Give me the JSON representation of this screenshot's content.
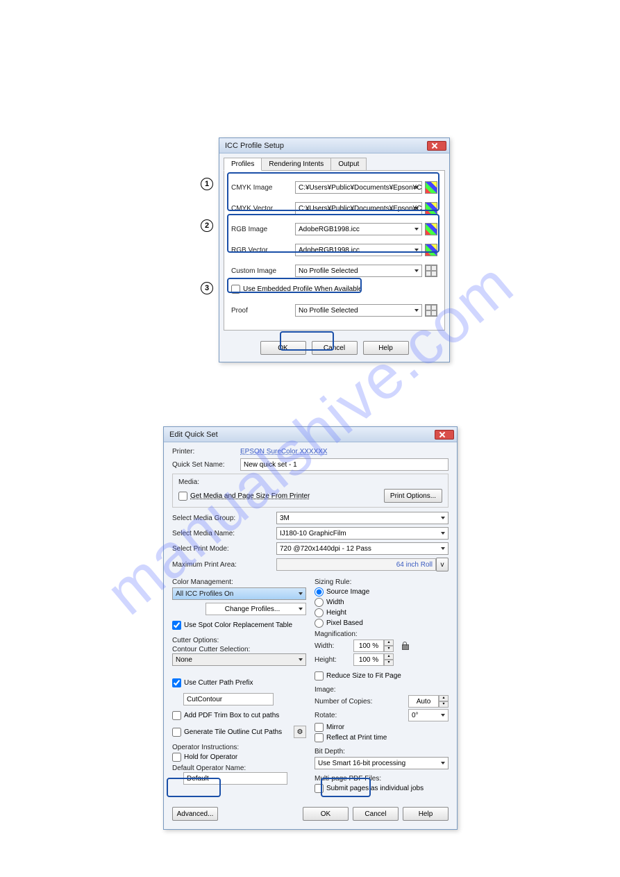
{
  "watermark": "manualshive.com",
  "icc": {
    "title": "ICC Profile Setup",
    "tabs": [
      "Profiles",
      "Rendering Intents",
      "Output"
    ],
    "rows": {
      "cmyk_image": {
        "label": "CMYK Image",
        "value": "C:¥Users¥Public¥Documents¥Epson¥C"
      },
      "cmyk_vector": {
        "label": "CMYK Vector",
        "value": "C:¥Users¥Public¥Documents¥Epson¥C"
      },
      "rgb_image": {
        "label": "RGB Image",
        "value": "AdobeRGB1998.icc"
      },
      "rgb_vector": {
        "label": "RGB Vector",
        "value": "AdobeRGB1998.icc"
      },
      "custom_image": {
        "label": "Custom Image",
        "value": "No Profile Selected"
      },
      "proof": {
        "label": "Proof",
        "value": "No Profile Selected"
      }
    },
    "use_embedded": "Use Embedded Profile When Available",
    "buttons": {
      "ok": "OK",
      "cancel": "Cancel",
      "help": "Help"
    },
    "callouts": {
      "one": "1",
      "two": "2",
      "three": "3"
    }
  },
  "eqs": {
    "title": "Edit Quick Set",
    "printer_label": "Printer:",
    "printer_value": "EPSON SureColor XXXXXX",
    "qsn_label": "Quick Set Name:",
    "qsn_value": "New quick set - 1",
    "media_legend": "Media:",
    "get_media": "Get Media and Page Size From Printer",
    "print_options": "Print Options...",
    "select_media_group": {
      "label": "Select Media Group:",
      "value": "3M"
    },
    "select_media_name": {
      "label": "Select Media Name:",
      "value": "IJ180-10 GraphicFilm"
    },
    "select_print_mode": {
      "label": "Select Print Mode:",
      "value": "720 @720x1440dpi - 12 Pass"
    },
    "max_print_area": {
      "label": "Maximum Print Area:",
      "value": "64 inch Roll",
      "v": "v"
    },
    "color_mgmt": "Color Management:",
    "all_icc": "All ICC Profiles On",
    "change_profiles": "Change Profiles...",
    "use_spot": "Use Spot Color Replacement Table",
    "cutter_options": "Cutter Options:",
    "contour_cutter": "Contour Cutter Selection:",
    "contour_cutter_value": "None",
    "use_cutter_prefix": "Use Cutter Path Prefix",
    "cutter_prefix_value": "CutContour",
    "add_pdf_trim": "Add PDF Trim Box to cut paths",
    "gen_tile_outline": "Generate Tile Outline Cut Paths",
    "op_instructions": "Operator Instructions:",
    "hold_operator": "Hold for Operator",
    "default_op_name": "Default Operator Name:",
    "default_value": "Default",
    "sizing_rule": "Sizing Rule:",
    "sizing_source": "Source Image",
    "sizing_width": "Width",
    "sizing_height": "Height",
    "sizing_pixel": "Pixel Based",
    "magnification": "Magnification:",
    "mag_width": {
      "label": "Width:",
      "value": "100 %"
    },
    "mag_height": {
      "label": "Height:",
      "value": "100 %"
    },
    "reduce_fit": "Reduce Size to Fit Page",
    "image": "Image:",
    "num_copies": {
      "label": "Number of Copies:",
      "value": "Auto"
    },
    "rotate": {
      "label": "Rotate:",
      "value": "0°"
    },
    "mirror": "Mirror",
    "reflect": "Reflect at Print time",
    "bit_depth": "Bit Depth:",
    "bit_depth_value": "Use Smart 16-bit processing",
    "multipage": "Multi-page PDF Files:",
    "submit_pages": "Submit pages as individual jobs",
    "advanced": "Advanced...",
    "ok": "OK",
    "cancel": "Cancel",
    "help": "Help"
  }
}
